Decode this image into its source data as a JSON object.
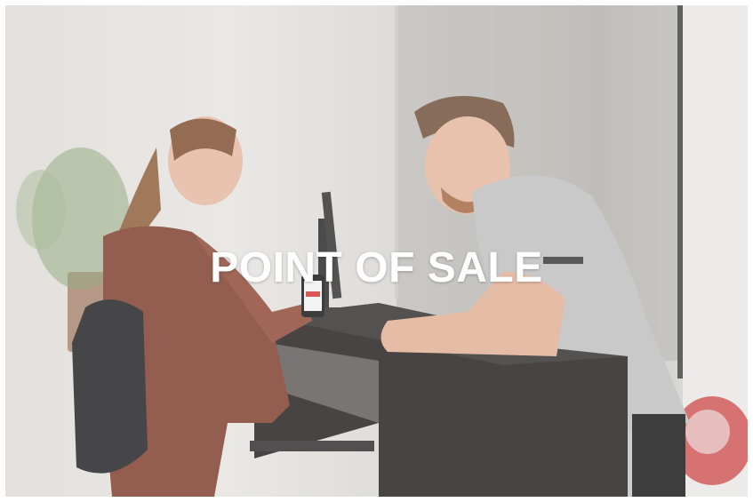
{
  "hero": {
    "title": "POINT OF SALE"
  },
  "colors": {
    "title_text": "#ffffff",
    "jacket": "#7a3a26",
    "counter": "#1e1a1a",
    "shirt": "#bdbdbd"
  },
  "scene": {
    "icons": [
      "woman-customer-icon",
      "cashier-man-icon",
      "pos-terminal-icon",
      "smartphone-icon",
      "counter-desk-icon",
      "plant-icon",
      "backpack-icon"
    ]
  }
}
